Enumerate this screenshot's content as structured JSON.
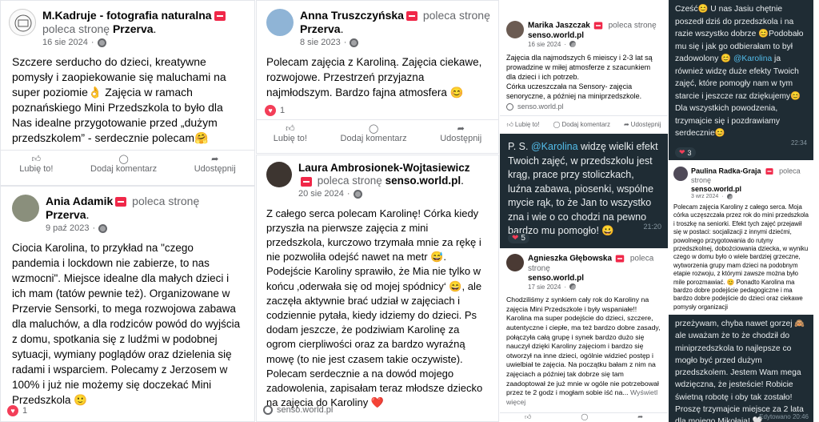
{
  "common": {
    "recommends": "poleca stronę",
    "like": "Lubię to!",
    "comment": "Dodaj komentarz",
    "share": "Udostępnij"
  },
  "reviews": [
    {
      "name": "M.Kadruje - fotografia naturalna",
      "page": "Przerva",
      "date": "16 sie 2024",
      "text": "Szczere serducho do dzieci, kreatywne pomysły i zaopiekowanie się maluchami na super poziomie👌 Zajęcia w ramach poznańskiego Mini Przedszkola to było dla Nas idealne przygotowanie przed „dużym przedszkolem” - serdecznie polecam🤗"
    },
    {
      "name": "Ania Adamik",
      "page": "Przerva",
      "date": "9 paź 2023",
      "text": "Ciocia Karolina, to przykład na \"czego pandemia i lockdown nie zabierze, to nas wzmocni\". Miejsce idealne dla małych dzieci i ich mam (tatów pewnie też). Organizowane w Przervie Sensorki, to mega rozwojowa zabawa dla maluchów, a dla rodziców powód do wyjścia z domu, spotkania się z ludźmi w podobnej sytuacji, wymiany poglądów oraz dzielenia się radami i wsparciem. Polecamy z Jerzosem w 100% i już nie możemy się doczekać Mini Przedszkola 🙂",
      "reactions": "1"
    },
    {
      "name": "Anna Truszczyńska",
      "page": "Przerva",
      "date": "8 sie 2023",
      "text": "Polecam zajęcia z Karoliną. Zajęcia ciekawe, rozwojowe. Przestrzeń przyjazna najmłodszym. Bardzo fajna atmosfera 😊",
      "reactions": "1"
    },
    {
      "name": "Laura Ambrosionek-Wojtasiewicz",
      "page": "senso.world.pl",
      "date": "20 sie 2024",
      "text": "Z całego serca polecam Karolinę! Córka kiedy przyszła na pierwsze zajęcia z mini przedszkola, kurczowo trzymała mnie za rękę i nie pozwoliła odejść nawet na metr 😅. Podejście Karoliny sprawiło, że Mia nie tylko w końcu ‚oderwała się od mojej spódnicy‘ 😄, ale zaczęła aktywnie brać udział w zajęciach i codziennie pytała, kiedy idziemy do dzieci. Ps dodam jeszcze, że podziwiam Karolinę za ogrom cierpliwości oraz za bardzo wyraźną mowę (to nie jest czasem takie oczywiste). Polecam serdecznie a na dowód mojego zadowolenia, zapisałam teraz młodsze dziecko na zajęcia do Karoliny ❤️",
      "source": "senso.world.pl"
    },
    {
      "name": "Marika Jaszczak",
      "page": "senso.world.pl",
      "date": "16 sie 2024",
      "text": "Zajęcia dla najmodszych 6 mieiscy i 2-3 lat są prowadzine w miłej atmosferze z szacunkiem dla dzieci i ich potrzeb.\nCórka uczeszczała na Sensory- zajęcia senoryczne, a później na miniprzedszkole.",
      "source": "senso.world.pl"
    },
    {
      "name": "Agnieszka Głębowska",
      "page": "senso.world.pl",
      "date": "17 sie 2024",
      "text": "Chodziliśmy z synkiem cały rok do Karoliny na zajęcia Mini Przedszkole i były wspaniałe!! Karolina ma super podejście do dzieci, szczere, autentyczne i ciepłe, ma też bardzo dobre zasady, połączyła całą grupę i synek bardzo dużo się nauczył dzięki Karoliny zajęciom i bardzo się otworzył na inne dzieci, ogólnie widzieć postęp i uwielbiał te zajęcia. Na początku bałam z nim na zajęciach a później tak dobrze się tam zaadoptował że już mnie w ogóle nie potrzebował przez te 2 godz i mogłam sobie iść na...",
      "more": "Wyświetl więcej"
    },
    {
      "name": "Paulina Radka-Graja",
      "page": "senso.world.pl",
      "date": "3 wrz 2024",
      "text": "Polecam zajęcia Karoliny z całego serca. Moja córka uczęszczała przez rok do mini przedszkola i troszkę na seniorki. Efekt tych zajęć przejawił się w postaci: socjalizacji z innymi dziećmi, powolnego przygotowania do rutyny przedszkolnej, dobożciowania dziecka, w wyniku czego w domu było o wiele bardziej grzeczne, wytworzenia grupy mam dzieci na podobnym etapie rozwoju, z którymi zawsze można było mile porozmawiać. 😊 Ponadto Karolina ma bardzo dobre podejście pedagogiczne i ma bardzo dobre podejście do dzieci oraz ciekawe pomysły organizacji"
    }
  ],
  "chats": [
    {
      "text_before": "P. S. ",
      "mention": "@Karolina",
      "text_after": " widzę wielki efekt Twoich zajęć, w przedszkolu jest krąg, prace przy stoliczkach, luźna zabawa, piosenki, wspólne mycie rąk, to że Jan to wszystko zna i wie o co chodzi na pewno bardzo mu pomogło! 😀",
      "time": "21:20",
      "hearts": "5"
    },
    {
      "text_before": "Cześć😊 U nas Jasiu chętnie poszedł dziś do przedszkola i na razie wszystko dobrze 😊Podobało mu się i jak go odbierałam to był zadowolony 😊 ",
      "mention": "@Karolina",
      "text_after": " ja również widzę duże efekty Twoich zajęć, które pomogły nam w tym starcie i jeszcze raz dziękujemy😊 Dla wszystkich powodzenia, trzymajcie się i pozdrawiamy serdecznie😊",
      "time": "22:34",
      "hearts": "3"
    },
    {
      "text_before": "przeżywam, chyba nawet gorzej 🙈 ale uważam że to że chodził do miniprzedszkola to najlepsze co mogło być przed dużym przedszkolem. Jestem Wam mega wdzięczna, że jesteście! Robicie świetną robotę i oby tak zostało! Proszę trzymajcie miejsce za 2 lata dla mojego Mikołaja! 🤍",
      "mention": "",
      "text_after": "",
      "time": "Edytowano 20:46",
      "hearts": ""
    }
  ]
}
